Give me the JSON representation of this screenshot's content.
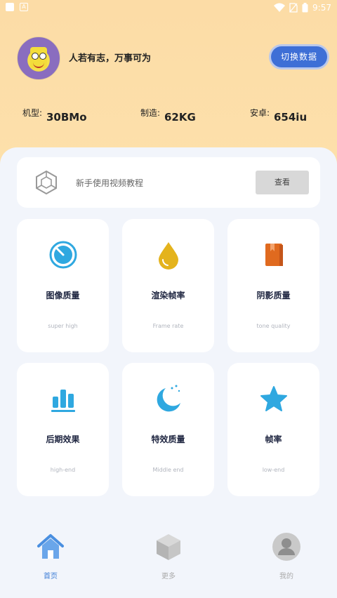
{
  "status_bar": {
    "time": "9:57"
  },
  "header": {
    "motto": "人若有志，万事可为",
    "switch_button": "切换数据"
  },
  "stats": [
    {
      "label": "机型:",
      "value": "30BMo"
    },
    {
      "label": "制造:",
      "value": "62KG"
    },
    {
      "label": "安卓:",
      "value": "654iu"
    }
  ],
  "tutorial": {
    "text": "新手使用视频教程",
    "button": "查看"
  },
  "cards": [
    {
      "title": "图像质量",
      "subtitle": "super high",
      "icon": "timer-icon",
      "color": "#2fa8e0"
    },
    {
      "title": "渲染帧率",
      "subtitle": "Frame rate",
      "icon": "drop-icon",
      "color": "#e4b31c"
    },
    {
      "title": "阴影质量",
      "subtitle": "tone quality",
      "icon": "book-icon",
      "color": "#e06a1f"
    },
    {
      "title": "后期效果",
      "subtitle": "high-end",
      "icon": "bar-chart-icon",
      "color": "#2fa8e0"
    },
    {
      "title": "特效质量",
      "subtitle": "Middle end",
      "icon": "moon-icon",
      "color": "#2fa8e0"
    },
    {
      "title": "帧率",
      "subtitle": "low-end",
      "icon": "star-icon",
      "color": "#2fa8e0"
    }
  ],
  "nav": [
    {
      "label": "首页",
      "icon": "home-icon",
      "active": true
    },
    {
      "label": "更多",
      "icon": "cube-icon",
      "active": false
    },
    {
      "label": "我的",
      "icon": "user-icon",
      "active": false
    }
  ]
}
